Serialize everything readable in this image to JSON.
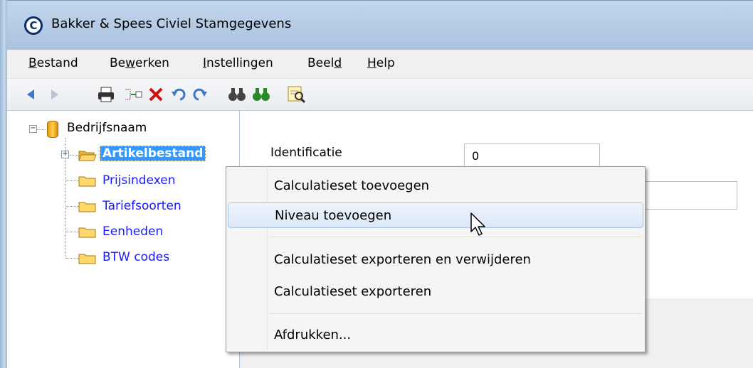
{
  "window": {
    "title": "Bakker & Spees Civiel Stamgegevens",
    "icon_letter": "C"
  },
  "menu": {
    "items": [
      {
        "pre": "",
        "ul": "B",
        "post": "estand"
      },
      {
        "pre": "Be",
        "ul": "w",
        "post": "erken"
      },
      {
        "pre": "",
        "ul": "I",
        "post": "nstellingen"
      },
      {
        "pre": "Beel",
        "ul": "d",
        "post": ""
      },
      {
        "pre": "",
        "ul": "H",
        "post": "elp"
      }
    ]
  },
  "toolbar": {
    "icons": [
      "back-arrow-icon",
      "forward-arrow-icon",
      "print-icon",
      "insert-icon",
      "delete-icon",
      "undo-icon",
      "redo-icon",
      "find-icon",
      "find-next-icon",
      "zoom-query-icon"
    ]
  },
  "tree": {
    "root": "Bedrijfsnaam",
    "children": [
      "Artikelbestand",
      "Prijsindexen",
      "Tariefsoorten",
      "Eenheden",
      "BTW codes"
    ]
  },
  "form": {
    "identificatie_label": "Identificatie",
    "identificatie_value": "0"
  },
  "context_menu": {
    "items": [
      "Calculatieset toevoegen",
      "Niveau toevoegen",
      "Calculatieset exporteren en verwijderen",
      "Calculatieset exporteren",
      "Afdrukken..."
    ]
  }
}
